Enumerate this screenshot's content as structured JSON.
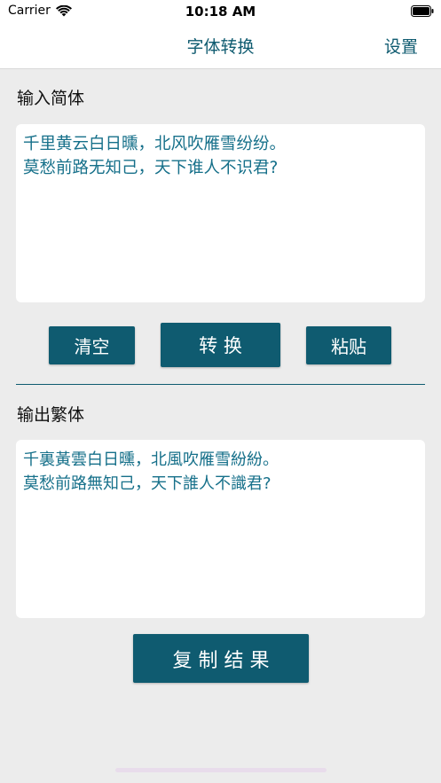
{
  "status_bar": {
    "carrier": "Carrier",
    "time": "10:18 AM"
  },
  "nav": {
    "title": "字体转换",
    "settings_label": "设置"
  },
  "input_section": {
    "label": "输入简体",
    "text": "千里黄云白日曛，北风吹雁雪纷纷。\n莫愁前路无知己，天下谁人不识君?"
  },
  "buttons": {
    "clear_label": "清空",
    "convert_label": "转 换",
    "paste_label": "粘贴",
    "copy_label": "复 制 结 果"
  },
  "output_section": {
    "label": "输出繁体",
    "text": "千裏黃雲白日曛，北風吹雁雪紛紛。\n莫愁前路無知己，天下誰人不識君?"
  },
  "colors": {
    "accent": "#0f5b70",
    "text_accent": "#16708a",
    "background": "#ececec"
  },
  "icons": {
    "wifi": "wifi-icon",
    "battery": "battery-icon"
  }
}
